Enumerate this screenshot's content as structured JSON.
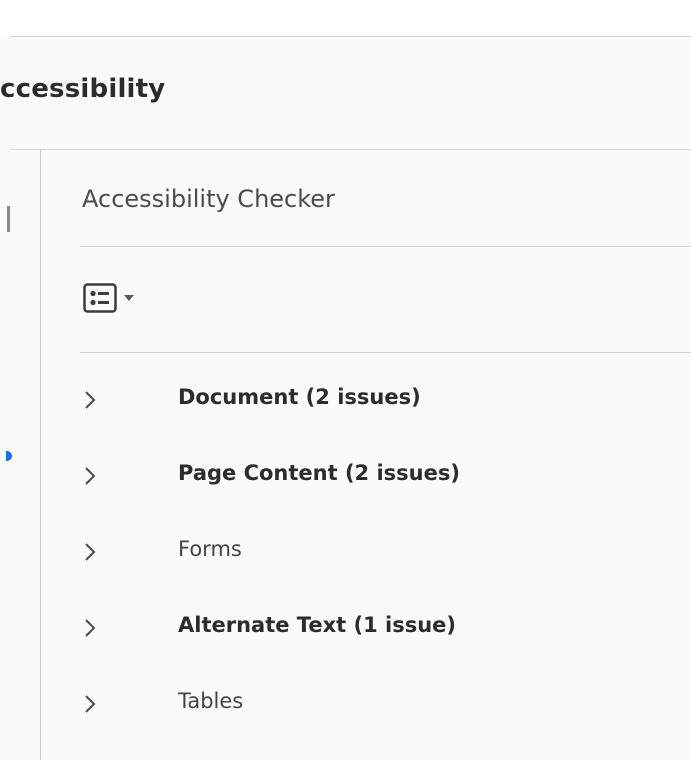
{
  "tool": {
    "title": "ccessibility"
  },
  "panel": {
    "title": "Accessibility Checker",
    "options_icon": "list-options-icon",
    "options_caret_icon": "caret-down-icon"
  },
  "categories": [
    {
      "label": "Document (2 issues)",
      "bold": true,
      "icon": "chevron-right-icon"
    },
    {
      "label": "Page Content (2 issues)",
      "bold": true,
      "icon": "chevron-right-icon"
    },
    {
      "label": "Forms",
      "bold": false,
      "icon": "chevron-right-icon"
    },
    {
      "label": "Alternate Text (1 issue)",
      "bold": true,
      "icon": "chevron-right-icon"
    },
    {
      "label": "Tables",
      "bold": false,
      "icon": "chevron-right-icon"
    }
  ],
  "colors": {
    "accent": "#1473e6",
    "text_dark": "#2c2c2c",
    "text_regular": "#444444",
    "divider": "#d3d3d3"
  }
}
